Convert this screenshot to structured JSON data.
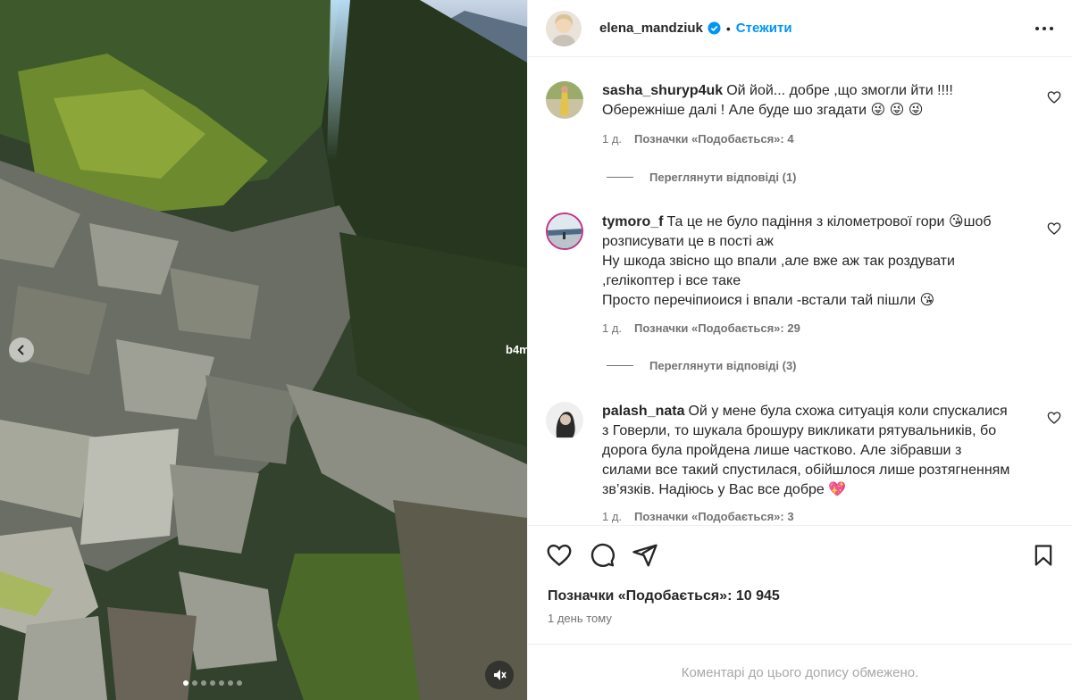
{
  "post": {
    "author": "elena_mandziuk",
    "separator": "•",
    "follow_label": "Стежити",
    "watermark": "b4m"
  },
  "comments": [
    {
      "username": "sasha_shuryp4uk",
      "text": "Ой йой... добре ,що змогли йти !!!! Обережніше далі ! Але буде шо згадати 😜 😜 😜",
      "age": "1 д.",
      "likes": "Позначки «Подобається»: 4",
      "replies": "Переглянути відповіді (1)"
    },
    {
      "username": "tymoro_f",
      "text": "Та це не було падіння з кілометрової гори 😘шоб розписувати це в пості аж",
      "text2": "Ну шкода звісно що впали ,але вже аж так роздувати ,гелікоптер і все таке",
      "text3": "Просто перечіпиоися і впали -встали тай пішли 😘",
      "age": "1 д.",
      "likes": "Позначки «Подобається»: 29",
      "replies": "Переглянути відповіді (3)"
    },
    {
      "username": "palash_nata",
      "text": "Ой у мене була схожа ситуація коли спускалися з Говерли, то шукала брошуру викликати рятувальників, бо дорога була пройдена лише частково. Але зібравши з силами все такий спустилася, обійшлося лише розтягненням зв’язків. Надіюсь у Вас все добре 💖",
      "age": "1 д.",
      "likes": "Позначки «Подобається»: 3"
    }
  ],
  "footer": {
    "likes_total": "Позначки «Подобається»: 10 945",
    "posted": "1 день тому",
    "comments_limited": "Коментарі до цього допису обмежено."
  },
  "colors": {
    "accent": "#0095f6",
    "muted": "#737373",
    "verified": "#0095f6"
  },
  "icons": [
    "chevron-left-icon",
    "mute-icon",
    "more-icon",
    "heart-icon",
    "comment-icon",
    "share-icon",
    "bookmark-icon",
    "verified-icon"
  ]
}
